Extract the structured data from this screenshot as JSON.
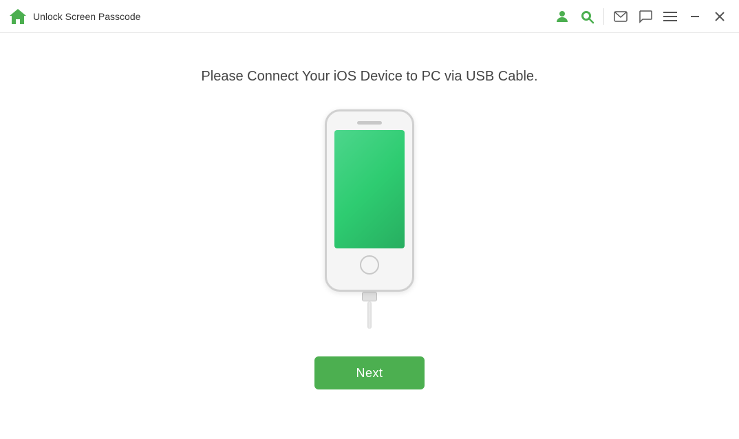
{
  "titleBar": {
    "appTitle": "Unlock Screen Passcode",
    "icons": {
      "user": "👤",
      "search": "🔍",
      "mail": "✉",
      "chat": "💬",
      "menu": "☰",
      "minimize": "—",
      "close": "✕"
    }
  },
  "main": {
    "instructionText": "Please Connect Your iOS Device to PC via USB Cable.",
    "nextButton": "Next"
  },
  "colors": {
    "green": "#4caf50",
    "screenGreen": "#2ecc71"
  }
}
